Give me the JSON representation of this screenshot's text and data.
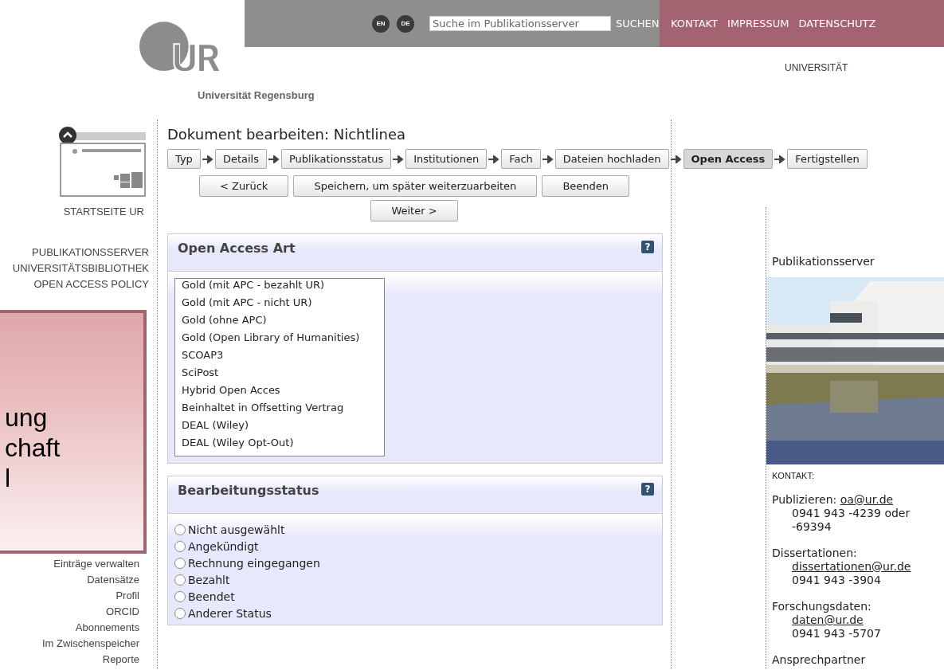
{
  "header": {
    "logo_caption": "Universität Regensburg",
    "languages": [
      {
        "label": "EN",
        "selected": false
      },
      {
        "label": "DE",
        "selected": false
      }
    ],
    "search": {
      "placeholder": "Suche im Publikationsserver",
      "button": "SUCHEN"
    },
    "links": [
      "KONTAKT",
      "IMPRESSUM",
      "DATENSCHUTZ"
    ],
    "subnav": "UNIVERSITÄT"
  },
  "sidebar": {
    "home": "STARTSEITE UR",
    "top_items": [
      "PUBLIKATIONSSERVER",
      "UNIVERSITÄTSBIBLIOTHEK",
      "OPEN ACCESS POLICY"
    ],
    "bottom_items": [
      "Einträge verwalten",
      "Datensätze",
      "Profil",
      "ORCID",
      "Abonnements",
      "Im Zwischenspeicher",
      "Reporte"
    ]
  },
  "overlay": {
    "lines": [
      "ung",
      "chaft",
      "l"
    ]
  },
  "main": {
    "title": "Dokument bearbeiten: Nichtlinea",
    "steps": [
      {
        "label": "Typ",
        "selected": false
      },
      {
        "label": "Details",
        "selected": false
      },
      {
        "label": "Publikationsstatus",
        "selected": false
      },
      {
        "label": "Institutionen",
        "selected": false
      },
      {
        "label": "Fach",
        "selected": false
      },
      {
        "label": "Dateien hochladen",
        "selected": false
      },
      {
        "label": "Open Access",
        "selected": true
      },
      {
        "label": "Fertigstellen",
        "selected": false
      }
    ],
    "actions": [
      "< Zurück",
      "Speichern, um später weiterzuarbeiten",
      "Beenden"
    ],
    "next": "Weiter >",
    "oa_section": {
      "title": "Open Access Art",
      "help": "?",
      "options": [
        {
          "label": "Gold (mit APC - bezahlt UR)",
          "selected": false
        },
        {
          "label": "Gold (mit APC - nicht UR)",
          "selected": false
        },
        {
          "label": "Gold (ohne APC)",
          "selected": false
        },
        {
          "label": "Gold (Open Library of Humanities)",
          "selected": false
        },
        {
          "label": "SCOAP3",
          "selected": false
        },
        {
          "label": "SciPost",
          "selected": false
        },
        {
          "label": "Hybrid Open Acces",
          "selected": false
        },
        {
          "label": "Beinhaltet in Offsetting Vertrag",
          "selected": false
        },
        {
          "label": "DEAL (Wiley)",
          "selected": false
        },
        {
          "label": "DEAL (Wiley Opt-Out)",
          "selected": false
        }
      ]
    },
    "status_section": {
      "title": "Bearbeitungsstatus",
      "help": "?",
      "options": [
        {
          "label": "Nicht ausgewählt",
          "checked": false
        },
        {
          "label": "Angekündigt",
          "checked": false
        },
        {
          "label": "Rechnung eingegangen",
          "checked": false
        },
        {
          "label": "Bezahlt",
          "checked": false
        },
        {
          "label": "Beendet",
          "checked": false
        },
        {
          "label": "Anderer Status",
          "checked": false
        }
      ]
    }
  },
  "right": {
    "title": "Publikationsserver",
    "contact_label": "KONTAKT:",
    "contacts": [
      {
        "label": "Publizieren:",
        "email": "oa@ur.de",
        "phone": "0941 943 -4239 oder -69394",
        "email_inline": true
      },
      {
        "label": "Dissertationen:",
        "email": "dissertationen@ur.de",
        "phone": "0941 943 -3904",
        "email_inline": false
      },
      {
        "label": "Forschungsdaten:",
        "email": "daten@ur.de",
        "phone": "0941 943 -5707",
        "email_inline": false
      }
    ],
    "more": "Ansprechpartner"
  }
}
